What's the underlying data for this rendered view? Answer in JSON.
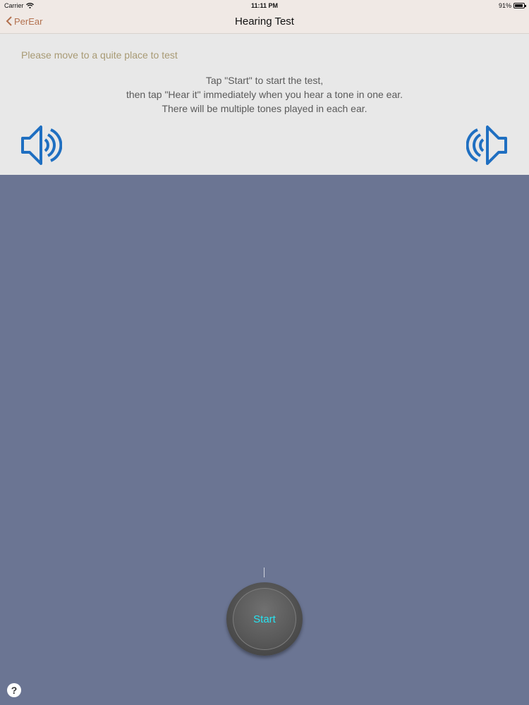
{
  "status_bar": {
    "carrier": "Carrier",
    "time": "11:11 PM",
    "battery": "91%",
    "battery_level": 0.91
  },
  "nav": {
    "back_label": "PerEar",
    "title": "Hearing Test"
  },
  "info": {
    "hint": "Please move to a quite place to test",
    "instructions": [
      "Tap \"Start\" to start the test,",
      "then tap \"Hear it\" immediately when you hear a tone in one ear.",
      "There will be multiple tones played in each ear."
    ]
  },
  "controls": {
    "start_label": "Start",
    "help_label": "?"
  },
  "colors": {
    "accent": "#1f6fc1",
    "start_text": "#27e3f0",
    "back": "#b3714f",
    "background": "#6b7593"
  }
}
